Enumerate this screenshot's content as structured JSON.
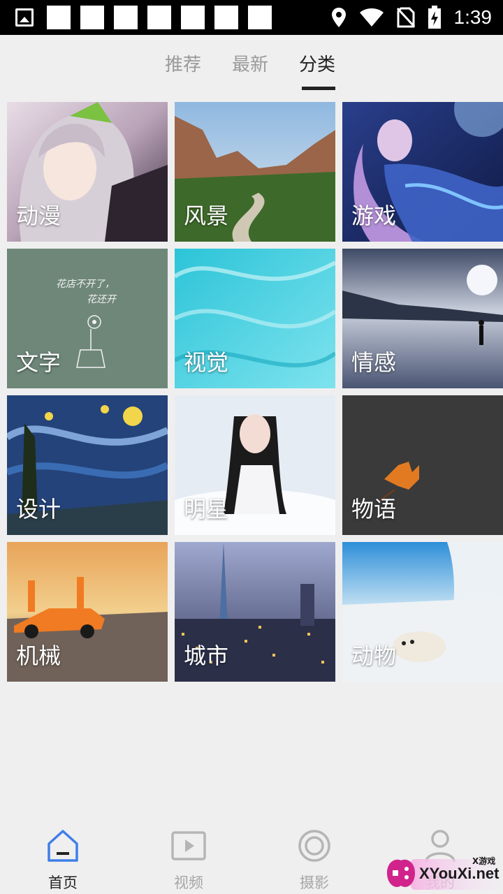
{
  "status_bar": {
    "time": "1:39",
    "icons": [
      "gallery-icon",
      "location-icon",
      "wifi-icon",
      "no-sim-icon",
      "battery-charging-icon"
    ]
  },
  "tabs": [
    {
      "label": "推荐",
      "active": false
    },
    {
      "label": "最新",
      "active": false
    },
    {
      "label": "分类",
      "active": true
    }
  ],
  "categories": [
    {
      "label": "动漫",
      "image": "anime girl with silver hair"
    },
    {
      "label": "风景",
      "image": "canyon with river"
    },
    {
      "label": "游戏",
      "image": "game character in blue"
    },
    {
      "label": "文字",
      "image": "handwritten text with flower pot"
    },
    {
      "label": "视觉",
      "image": "turquoise swirl"
    },
    {
      "label": "情感",
      "image": "person standing by lake"
    },
    {
      "label": "设计",
      "image": "starry night painting"
    },
    {
      "label": "明星",
      "image": "woman in white"
    },
    {
      "label": "物语",
      "image": "orange leaf on asphalt"
    },
    {
      "label": "机械",
      "image": "orange sports car"
    },
    {
      "label": "城市",
      "image": "city skyline at night"
    },
    {
      "label": "动物",
      "image": "seal pup in snow"
    }
  ],
  "text_card_handwriting": [
    "花店不开了，",
    "花还开"
  ],
  "bottom_nav": [
    {
      "label": "首页",
      "icon": "home-icon",
      "active": true
    },
    {
      "label": "视频",
      "icon": "video-play-icon",
      "active": false
    },
    {
      "label": "摄影",
      "icon": "camera-lens-icon",
      "active": false
    },
    {
      "label": "我的",
      "icon": "user-icon",
      "active": false
    }
  ],
  "watermark": {
    "text": "XYouXi.net",
    "small": "X游戏"
  },
  "colors": {
    "accent": "#3f7ee8",
    "active_text": "#222222",
    "inactive_text": "#9a9a9a",
    "background": "#efefef"
  }
}
